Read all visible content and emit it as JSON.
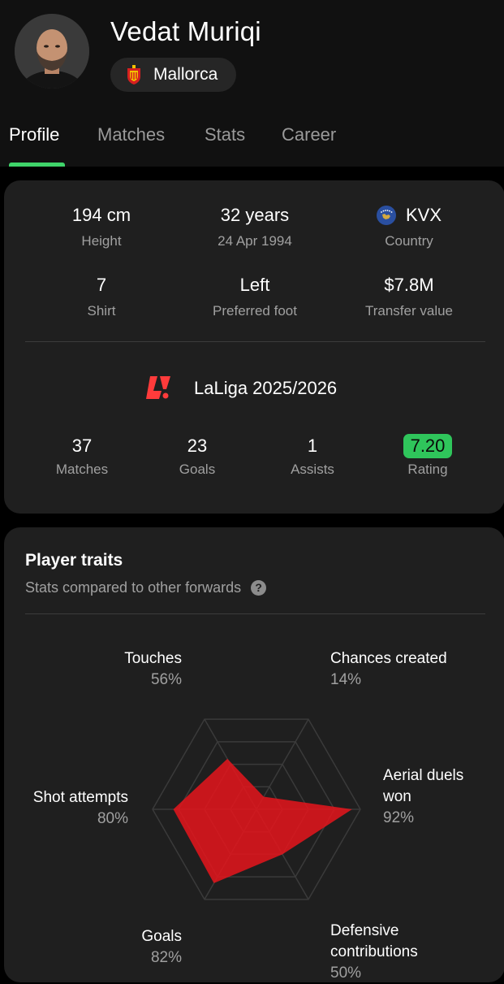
{
  "player": {
    "name": "Vedat Muriqi",
    "club": "Mallorca"
  },
  "tabs": [
    {
      "label": "Profile",
      "active": true
    },
    {
      "label": "Matches",
      "active": false
    },
    {
      "label": "Stats",
      "active": false
    },
    {
      "label": "Career",
      "active": false
    }
  ],
  "info": {
    "height": {
      "value": "194 cm",
      "label": "Height"
    },
    "age": {
      "value": "32 years",
      "label": "24 Apr 1994"
    },
    "country": {
      "value": "KVX",
      "label": "Country"
    },
    "shirt": {
      "value": "7",
      "label": "Shirt"
    },
    "foot": {
      "value": "Left",
      "label": "Preferred foot"
    },
    "transfer": {
      "value": "$7.8M",
      "label": "Transfer value"
    }
  },
  "league": {
    "name": "LaLiga 2025/2026",
    "stats": [
      {
        "value": "37",
        "label": "Matches"
      },
      {
        "value": "23",
        "label": "Goals"
      },
      {
        "value": "1",
        "label": "Assists"
      },
      {
        "value": "7.20",
        "label": "Rating"
      }
    ]
  },
  "traits": {
    "title": "Player traits",
    "subtitle": "Stats compared to other forwards",
    "items": [
      {
        "label": "Touches",
        "label2": "",
        "percent": "56%",
        "value": 56
      },
      {
        "label": "Chances created",
        "label2": "",
        "percent": "14%",
        "value": 14
      },
      {
        "label": "Aerial duels",
        "label2": "won",
        "percent": "92%",
        "value": 92
      },
      {
        "label": "Defensive",
        "label2": "contributions",
        "percent": "50%",
        "value": 50
      },
      {
        "label": "Goals",
        "label2": "",
        "percent": "82%",
        "value": 82
      },
      {
        "label": "Shot attempts",
        "label2": "",
        "percent": "80%",
        "value": 80
      }
    ]
  },
  "colors": {
    "accent": "#3fd46a",
    "rating": "#2fc55b",
    "radar_fill": "#e0161c",
    "background": "#000000",
    "card": "#1f1f1f"
  },
  "icons": [
    "player-photo",
    "mallorca-crest-icon",
    "kosovo-flag-icon",
    "laliga-logo-icon",
    "help-icon"
  ]
}
